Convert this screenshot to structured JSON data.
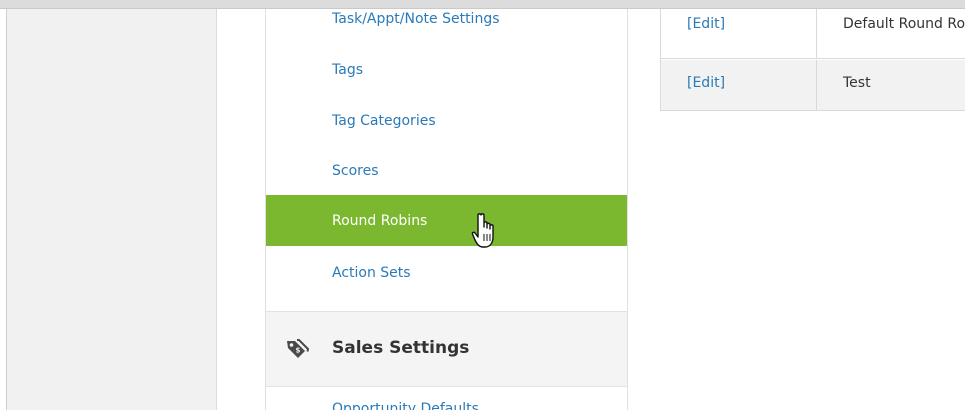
{
  "sidebar": {
    "items": [
      {
        "label": "Task/Appt/Note Settings"
      },
      {
        "label": "Tags"
      },
      {
        "label": "Tag Categories"
      },
      {
        "label": "Scores"
      },
      {
        "label": "Round Robins",
        "active": true
      },
      {
        "label": "Action Sets"
      }
    ],
    "section": {
      "label": "Sales Settings",
      "icon": "tags-icon"
    },
    "next_item_label": "Opportunity Defaults"
  },
  "table": {
    "rows": [
      {
        "edit_label": "[Edit]",
        "name": "Default Round Robin"
      },
      {
        "edit_label": "[Edit]",
        "name": "Test"
      }
    ]
  },
  "colors": {
    "accent": "#7cb82f",
    "link": "#2a7ab8"
  }
}
